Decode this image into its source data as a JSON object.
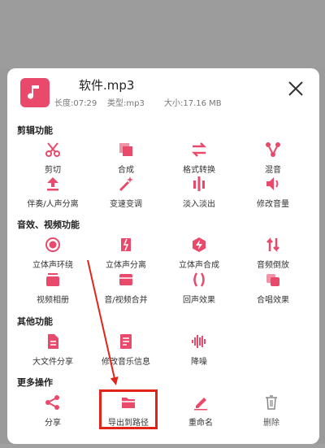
{
  "file": {
    "name": "软件.mp3",
    "length": "长度:07:29",
    "type": "类型:mp3",
    "size": "大小:17.16 MB"
  },
  "sections": {
    "edit": "剪辑功能",
    "effects": "音效、视频功能",
    "other": "其他功能",
    "more": "更多操作"
  },
  "edit_items": [
    "剪切",
    "合成",
    "格式转换",
    "混音",
    "伴奏/人声分离",
    "变速变调",
    "淡入淡出",
    "修改音量"
  ],
  "effects_items": [
    "立体声环绕",
    "立体声分离",
    "立体声合成",
    "音频倒放",
    "视频相册",
    "音/视频合并",
    "回声效果",
    "合唱效果"
  ],
  "other_items": [
    "大文件分享",
    "修改音乐信息",
    "降噪"
  ],
  "more_items": [
    "分享",
    "导出到路径",
    "重命名",
    "删除"
  ],
  "colors": {
    "accent": "#e94a6b",
    "highlight": "#e1251b"
  }
}
